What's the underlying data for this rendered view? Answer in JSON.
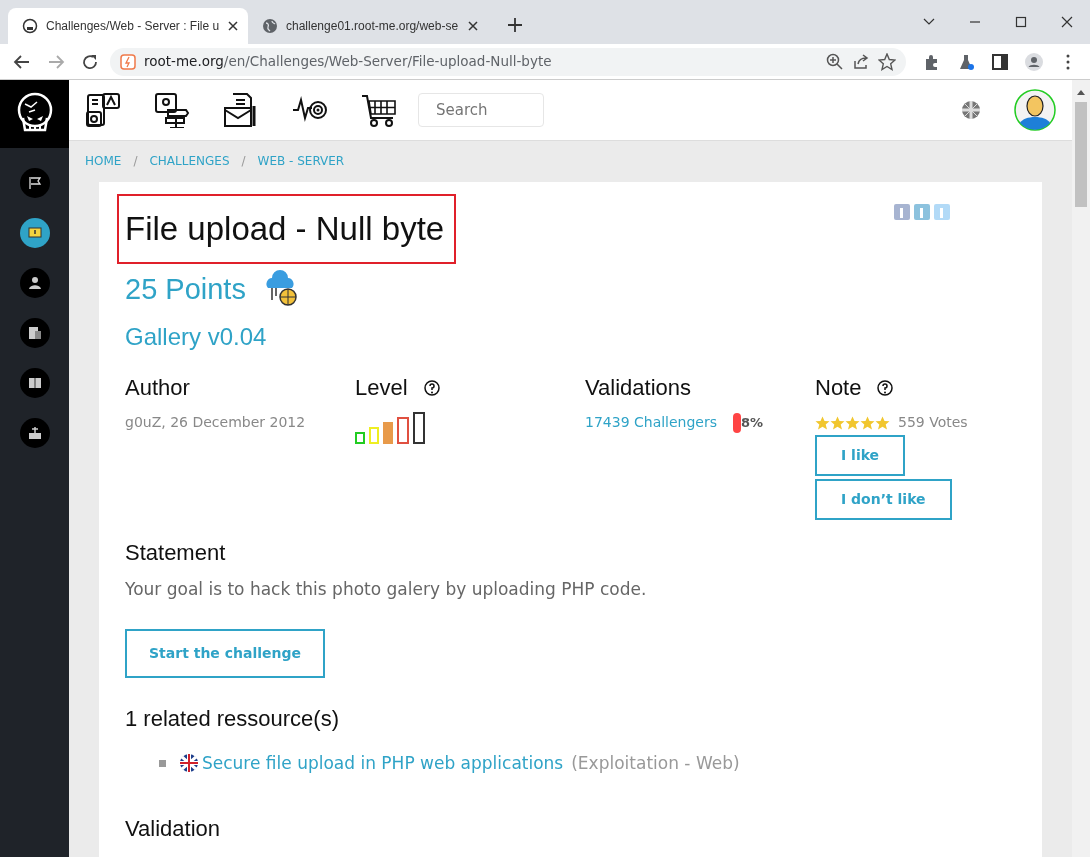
{
  "browser": {
    "tabs": [
      {
        "title": "Challenges/Web - Server : File u",
        "kind": "site",
        "selected": true
      },
      {
        "title": "challenge01.root-me.org/web-se",
        "kind": "globe",
        "selected": false
      }
    ],
    "address": {
      "host": "root-me.org",
      "path": "/en/Challenges/Web-Server/File-upload-Null-byte"
    }
  },
  "header": {
    "search": {
      "placeholder": "Search"
    }
  },
  "sidebar": {
    "items": [
      {
        "selected": false
      },
      {
        "selected": true
      },
      {
        "selected": false
      },
      {
        "selected": false
      },
      {
        "selected": false
      },
      {
        "selected": false
      }
    ]
  },
  "breadcrumb": [
    "HOME",
    "CHALLENGES",
    "WEB - SERVER"
  ],
  "breadcrumb_separators": [
    "/",
    "/"
  ],
  "challenge": {
    "title": "File upload - Null byte",
    "highlighted": true,
    "points": "25 Points",
    "subtitle": "Gallery v0.04",
    "author": {
      "heading": "Author",
      "value": "g0uZ,  26 December 2012"
    },
    "level": {
      "heading": "Level",
      "bars": [
        {
          "color": "#22cc22",
          "filled": false
        },
        {
          "color": "#eeee22",
          "filled": false
        },
        {
          "color": "#e89a4a",
          "filled": true
        },
        {
          "color": "#e05040",
          "filled": false
        },
        {
          "color": "#333333",
          "filled": false
        }
      ]
    },
    "validations": {
      "heading": "Validations",
      "link": "17439 Challengers",
      "percent": "8%"
    },
    "note": {
      "heading": "Note",
      "stars": 5,
      "votes": "559 Votes",
      "buttons": [
        "I like",
        "I don’t like"
      ]
    },
    "statement": {
      "heading": "Statement",
      "text": "Your goal is to hack this photo galery by uploading PHP code.",
      "button": "Start the challenge"
    },
    "resources": {
      "heading": "1 related ressource(s)",
      "items": [
        {
          "link": "Secure file upload in PHP web applications",
          "note": "(Exploitation - Web)"
        }
      ]
    },
    "validation": {
      "heading": "Validation"
    }
  }
}
